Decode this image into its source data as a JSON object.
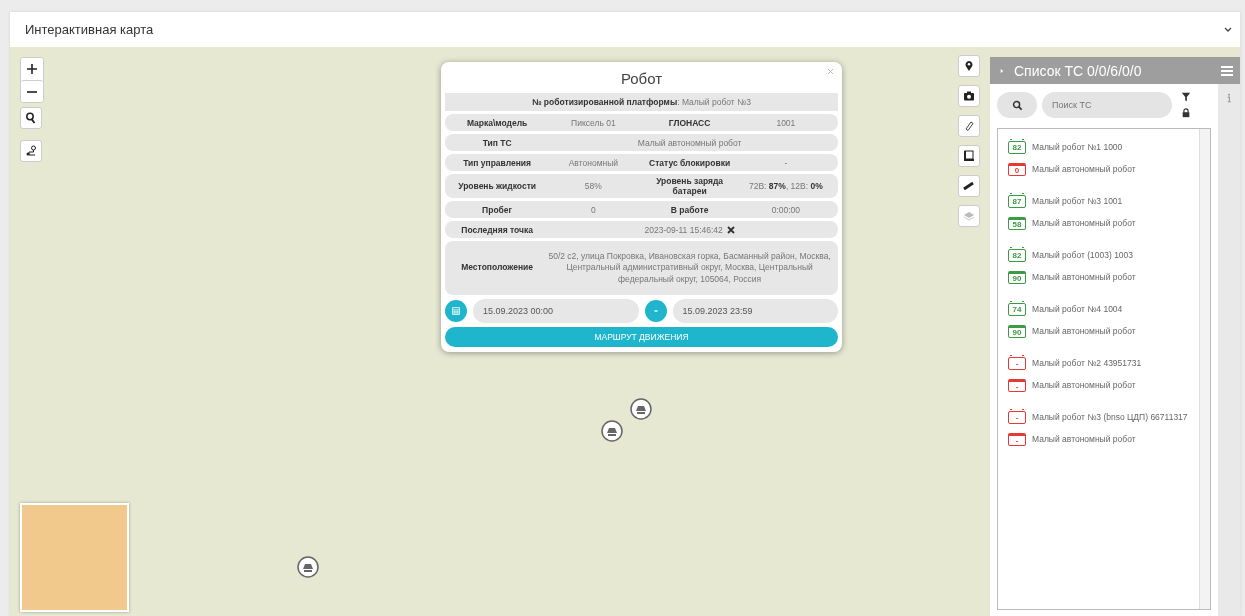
{
  "header": {
    "title": "Интерактивная карта"
  },
  "popup": {
    "title": "Робот",
    "platform": "**№ роботизированной платформы**: Малый робот №3",
    "rows": [
      {
        "kind": "pair",
        "label": "Марка\\модель",
        "value": "Пиксель 01",
        "label2": "ГЛОНАСС",
        "value2": "1001"
      },
      {
        "kind": "wide",
        "label": "Тип ТС",
        "value": "Малый автономный робот"
      },
      {
        "kind": "pair",
        "label": "Тип управления",
        "value": "Автономный",
        "label2": "Статус блокировки",
        "value2": "-"
      },
      {
        "kind": "pair",
        "label": "Уровень жидкости",
        "value": "58%",
        "label2": "Уровень заряда батареи",
        "value2": "72В: **87%**, 12В: **0%**"
      },
      {
        "kind": "pair",
        "label": "Пробег",
        "value": "0",
        "label2": "В работе",
        "value2": "0:00:00"
      },
      {
        "kind": "point",
        "label": "Последняя точка",
        "value": "2023-09-11 15:46:42"
      },
      {
        "kind": "wide",
        "label": "Местоположение",
        "value": "50/2 с2, улица Покровка, Ивановская горка, Басманный район, Москва, Центральный административный округ, Москва, Центральный федеральный округ, 105064, Россия"
      }
    ],
    "date_from": "15.09.2023 00:00",
    "date_to": "15.09.2023 23:59",
    "route_button": "МАРШРУТ ДВИЖЕНИЯ"
  },
  "panel": {
    "title": "Список ТС 0/0/6/0/0",
    "search": {
      "placeholder": "Поиск ТС"
    },
    "vehicles": [
      {
        "lines": [
          {
            "kind": "battery",
            "badge": "82",
            "color": "#3d9a46",
            "text": "Малый робот №1 1000"
          },
          {
            "kind": "tank",
            "badge": "0",
            "color": "#e53935",
            "text": "Малый автономный робот"
          }
        ]
      },
      {
        "lines": [
          {
            "kind": "battery",
            "badge": "87",
            "color": "#3d9a46",
            "text": "Малый робот №3 1001"
          },
          {
            "kind": "tank",
            "badge": "58",
            "color": "#3d9a46",
            "text": "Малый автономный робот"
          }
        ]
      },
      {
        "lines": [
          {
            "kind": "battery",
            "badge": "82",
            "color": "#3d9a46",
            "text": "Малый робот (1003) 1003"
          },
          {
            "kind": "tank",
            "badge": "90",
            "color": "#3d9a46",
            "text": "Малый автономный робот"
          }
        ]
      },
      {
        "lines": [
          {
            "kind": "battery",
            "badge": "74",
            "color": "#3d9a46",
            "text": "Малый робот №4 1004"
          },
          {
            "kind": "tank",
            "badge": "90",
            "color": "#3d9a46",
            "text": "Малый автономный робот"
          }
        ]
      },
      {
        "lines": [
          {
            "kind": "battery",
            "badge": "-",
            "color": "#e53935",
            "text": "Малый робот №2 43951731"
          },
          {
            "kind": "tank",
            "badge": "-",
            "color": "#e53935",
            "text": "Малый автономный робот"
          }
        ]
      },
      {
        "lines": [
          {
            "kind": "battery",
            "badge": "-",
            "color": "#e53935",
            "text": "Малый робот №3 (bnso ЦДП) 66711317"
          },
          {
            "kind": "tank",
            "badge": "-",
            "color": "#e53935",
            "text": "Малый автономный робот"
          }
        ]
      }
    ]
  }
}
